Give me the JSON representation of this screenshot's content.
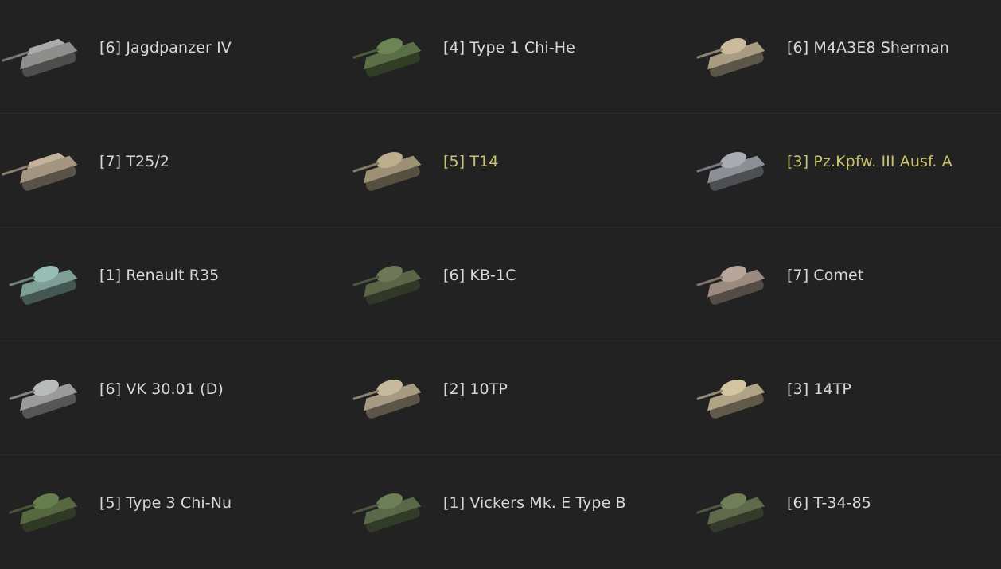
{
  "colors": {
    "background": "#222223",
    "text": "#d8d8d4",
    "premium_text": "#c9c46c",
    "divider": "#2b2b2c"
  },
  "rows": [
    [
      {
        "label": "[6] Jagdpanzer IV",
        "icon": "tank-destroyer-icon",
        "color": "#8d8f8c",
        "premium": false
      },
      {
        "label": "[4] Type 1 Chi-He",
        "icon": "tank-icon",
        "color": "#5a6f45",
        "premium": false
      },
      {
        "label": "[6] M4A3E8 Sherman",
        "icon": "tank-icon",
        "color": "#a89c82",
        "premium": false
      }
    ],
    [
      {
        "label": "[7] T25/2",
        "icon": "tank-destroyer-icon",
        "color": "#a39580",
        "premium": false
      },
      {
        "label": "[5] T14",
        "icon": "tank-icon",
        "color": "#9d9175",
        "premium": true
      },
      {
        "label": "[3] Pz.Kpfw. III Ausf. A",
        "icon": "tank-icon",
        "color": "#8c9096",
        "premium": true
      }
    ],
    [
      {
        "label": "[1] Renault R35",
        "icon": "tank-icon",
        "color": "#7e9e96",
        "premium": false
      },
      {
        "label": "[6] KB-1C",
        "icon": "tank-icon",
        "color": "#5b6548",
        "premium": false
      },
      {
        "label": "[7] Comet",
        "icon": "tank-icon",
        "color": "#9a8a80",
        "premium": false
      }
    ],
    [
      {
        "label": "[6] VK 30.01 (D)",
        "icon": "tank-icon",
        "color": "#9a9c9b",
        "premium": false
      },
      {
        "label": "[2] 10TP",
        "icon": "tank-icon",
        "color": "#a69a82",
        "premium": false
      },
      {
        "label": "[3] 14TP",
        "icon": "tank-icon",
        "color": "#b0a486",
        "premium": false
      }
    ],
    [
      {
        "label": "[5] Type 3 Chi-Nu",
        "icon": "tank-icon",
        "color": "#55683f",
        "premium": false
      },
      {
        "label": "[1] Vickers Mk. E Type B",
        "icon": "tank-icon",
        "color": "#5a6a48",
        "premium": false
      },
      {
        "label": "[6] T-34-85",
        "icon": "tank-icon",
        "color": "#5e6a4a",
        "premium": false
      }
    ]
  ]
}
